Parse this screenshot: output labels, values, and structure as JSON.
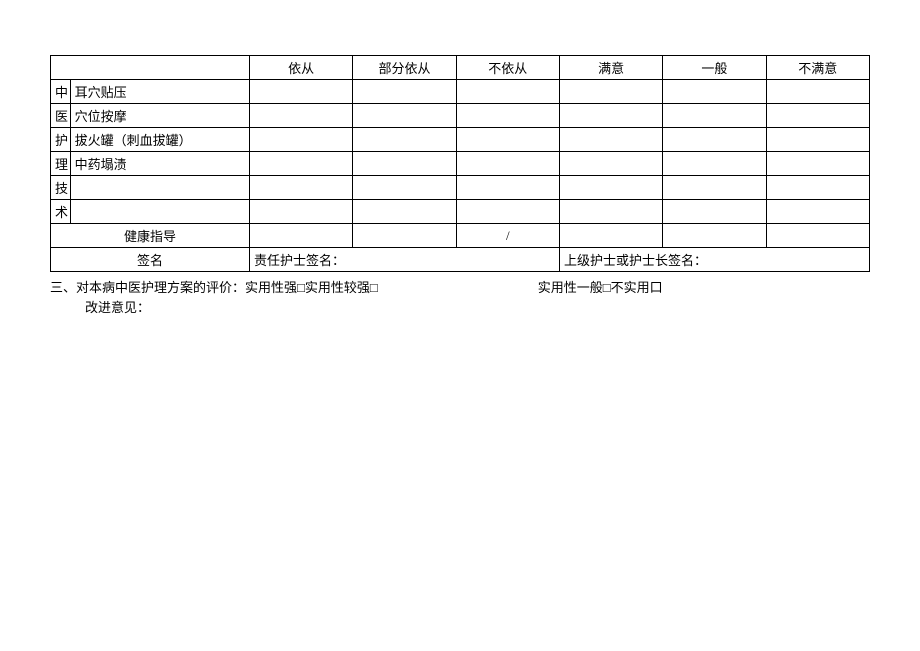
{
  "table": {
    "headers": [
      "依从",
      "部分依从",
      "不依从",
      "满意",
      "一般",
      "不满意"
    ],
    "sideLabel": [
      "中",
      "医",
      "护",
      "理",
      "技",
      "术"
    ],
    "rows": [
      "耳穴贴压",
      "穴位按摩",
      "拔火罐（刺血拔罐）",
      "中药塌渍",
      "",
      ""
    ],
    "guidanceLabel": "健康指导",
    "guidanceCells": [
      "",
      "",
      "/",
      "",
      "",
      ""
    ],
    "signatureLabel": "签名",
    "signatureLeft": "责任护士签名：",
    "signatureRight": "上级护士或护士长签名："
  },
  "footer": {
    "line1_prefix": "三、对本病中医护理方案的评价：",
    "line1_opt1": "实用性强□实用性较强□",
    "line1_opt2": "实用性一般□不实用口",
    "line2": "改进意见："
  }
}
